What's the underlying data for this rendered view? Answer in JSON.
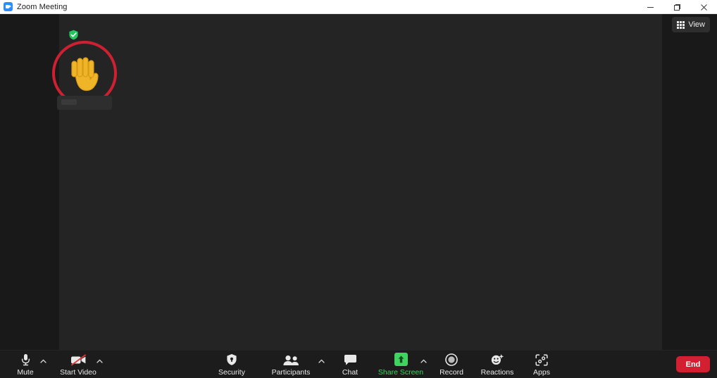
{
  "window": {
    "title": "Zoom Meeting",
    "app_icon": "zoom-logo-icon",
    "controls": {
      "minimize": "minimize-icon",
      "maximize": "restore-icon",
      "close": "close-icon"
    }
  },
  "stage": {
    "view_button": {
      "label": "View",
      "icon": "grid-icon"
    },
    "participant_tile": {
      "raised_hand": "raised-hand-emoji",
      "status_badge": "green-check-shield-icon"
    }
  },
  "toolbar": {
    "items": [
      {
        "label": "Mute",
        "icon": "microphone-icon",
        "has_caret": true,
        "active": false
      },
      {
        "label": "Start Video",
        "icon": "video-off-icon",
        "has_caret": true,
        "active": false
      },
      {
        "label": "Security",
        "icon": "shield-icon",
        "has_caret": false,
        "active": false
      },
      {
        "label": "Participants",
        "icon": "people-icon",
        "has_caret": true,
        "active": false
      },
      {
        "label": "Chat",
        "icon": "chat-bubble-icon",
        "has_caret": false,
        "active": false
      },
      {
        "label": "Share Screen",
        "icon": "share-screen-icon",
        "has_caret": true,
        "active": true
      },
      {
        "label": "Record",
        "icon": "record-icon",
        "has_caret": false,
        "active": false
      },
      {
        "label": "Reactions",
        "icon": "reactions-icon",
        "has_caret": false,
        "active": false
      },
      {
        "label": "Apps",
        "icon": "apps-icon",
        "has_caret": false,
        "active": false
      }
    ],
    "end_button": {
      "label": "End"
    }
  },
  "colors": {
    "accent_green": "#3fd45f",
    "end_red": "#d32030",
    "hand_circle_red": "#cf2032",
    "badge_green": "#22c55e",
    "panel_bg": "#242424",
    "app_bg": "#191919",
    "toolbar_bg": "#1c1c1c"
  }
}
